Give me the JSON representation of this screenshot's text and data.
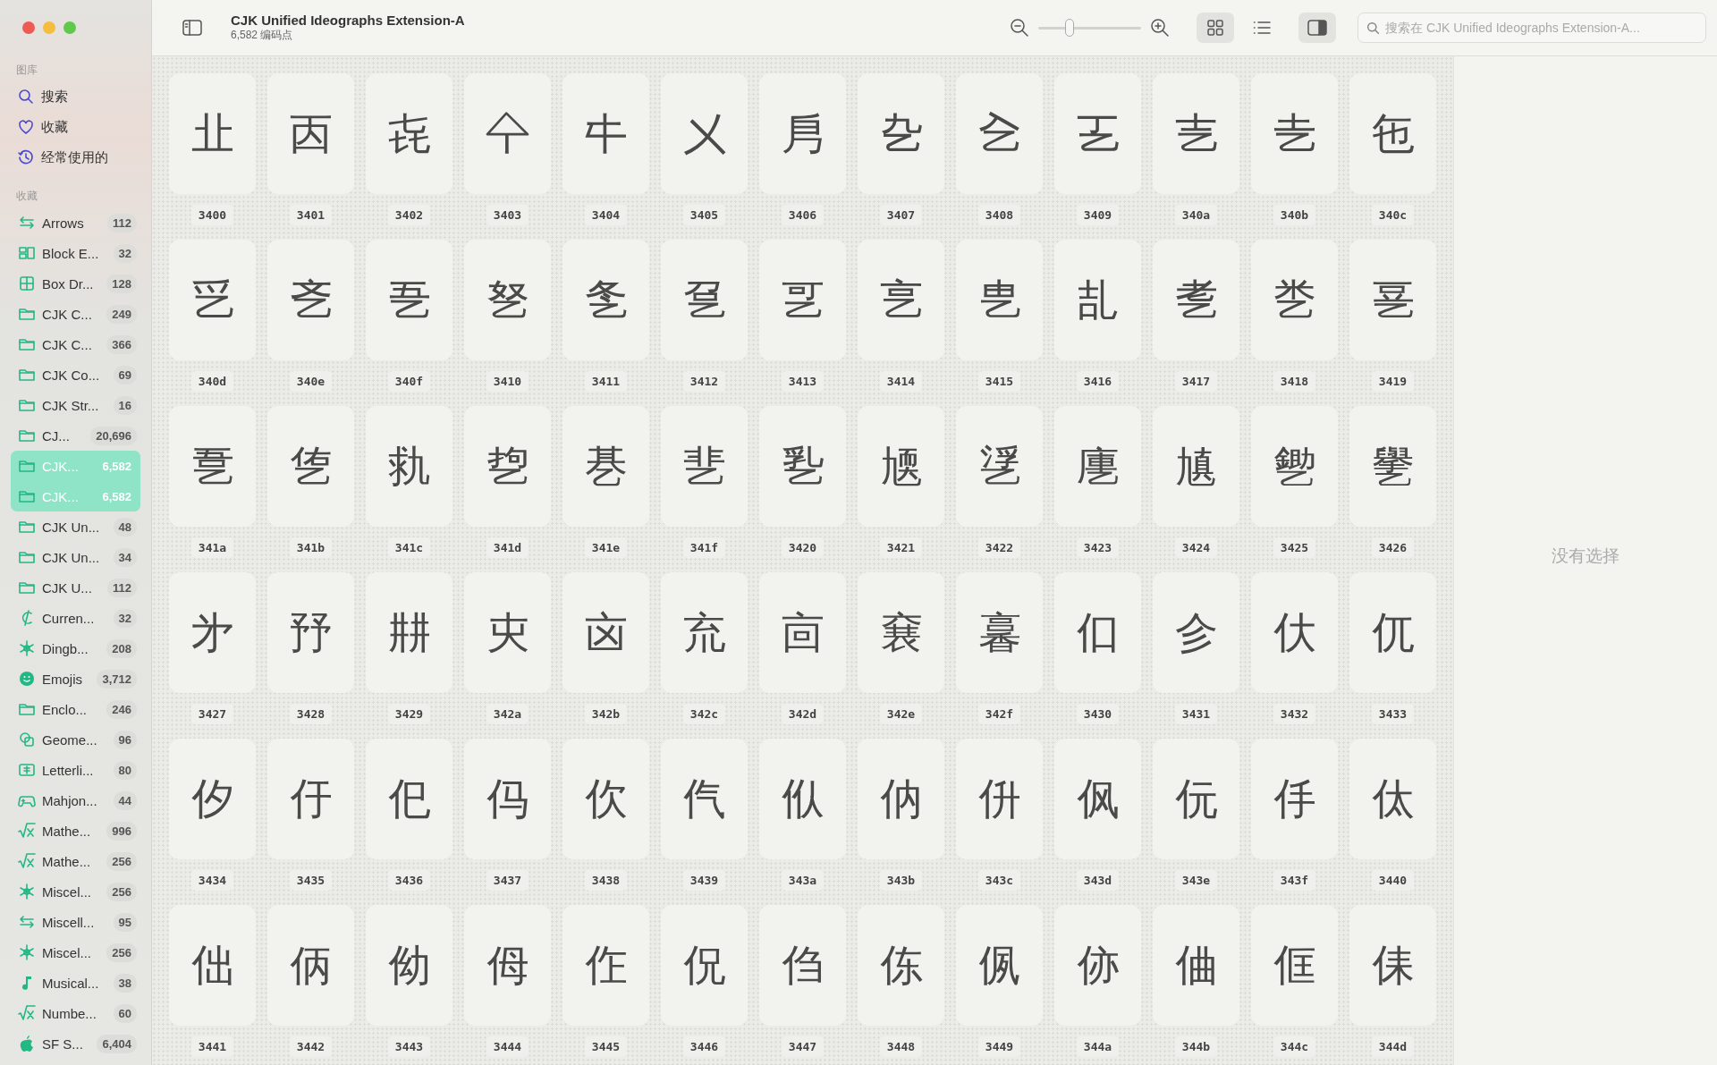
{
  "window": {
    "title": "CJK Unified Ideographs Extension-A",
    "subtitle": "6,582 编码点"
  },
  "sidebar": {
    "library_heading": "图库",
    "library": [
      {
        "label": "搜索",
        "kind": "search"
      },
      {
        "label": "收藏",
        "kind": "heart"
      },
      {
        "label": "经常使用的",
        "kind": "history"
      }
    ],
    "collections_heading": "收藏",
    "collections": [
      {
        "label": "Arrows",
        "count": "112",
        "kind": "arrows",
        "selected": false
      },
      {
        "label": "Block E...",
        "count": "32",
        "kind": "block",
        "selected": false
      },
      {
        "label": "Box Dr...",
        "count": "128",
        "kind": "box",
        "selected": false
      },
      {
        "label": "CJK C...",
        "count": "249",
        "kind": "folder",
        "selected": false
      },
      {
        "label": "CJK C...",
        "count": "366",
        "kind": "folder",
        "selected": false
      },
      {
        "label": "CJK Co...",
        "count": "69",
        "kind": "folder",
        "selected": false
      },
      {
        "label": "CJK Str...",
        "count": "16",
        "kind": "folder",
        "selected": false
      },
      {
        "label": "CJ...",
        "count": "20,696",
        "kind": "folder",
        "selected": false
      },
      {
        "label": "CJK...",
        "count": "6,582",
        "kind": "folder",
        "selected": true
      },
      {
        "label": "CJK...",
        "count": "6,582",
        "kind": "folder",
        "selected": true
      },
      {
        "label": "CJK Un...",
        "count": "48",
        "kind": "folder",
        "selected": false
      },
      {
        "label": "CJK Un...",
        "count": "34",
        "kind": "folder",
        "selected": false
      },
      {
        "label": "CJK U...",
        "count": "112",
        "kind": "folder",
        "selected": false
      },
      {
        "label": "Curren...",
        "count": "32",
        "kind": "currency",
        "selected": false
      },
      {
        "label": "Dingb...",
        "count": "208",
        "kind": "asterisk",
        "selected": false
      },
      {
        "label": "Emojis",
        "count": "3,712",
        "kind": "emoji",
        "selected": false
      },
      {
        "label": "Enclo...",
        "count": "246",
        "kind": "folder",
        "selected": false
      },
      {
        "label": "Geome...",
        "count": "96",
        "kind": "shapes",
        "selected": false
      },
      {
        "label": "Letterli...",
        "count": "80",
        "kind": "letterlike",
        "selected": false
      },
      {
        "label": "Mahjon...",
        "count": "44",
        "kind": "gamepad",
        "selected": false
      },
      {
        "label": "Mathe...",
        "count": "996",
        "kind": "math",
        "selected": false
      },
      {
        "label": "Mathe...",
        "count": "256",
        "kind": "math",
        "selected": false
      },
      {
        "label": "Miscel...",
        "count": "256",
        "kind": "asterisk",
        "selected": false
      },
      {
        "label": "Miscell...",
        "count": "95",
        "kind": "arrows",
        "selected": false
      },
      {
        "label": "Miscel...",
        "count": "256",
        "kind": "asterisk",
        "selected": false
      },
      {
        "label": "Musical...",
        "count": "38",
        "kind": "music",
        "selected": false
      },
      {
        "label": "Numbe...",
        "count": "60",
        "kind": "math",
        "selected": false
      },
      {
        "label": "SF S...",
        "count": "6,404",
        "kind": "apple",
        "selected": false
      }
    ]
  },
  "toolbar": {
    "zoom": {
      "level": 0.3
    },
    "views": [
      {
        "kind": "grid",
        "selected": true
      },
      {
        "kind": "list",
        "selected": false
      }
    ],
    "inspector_on": true,
    "search_placeholder": "搜索在 CJK Unified Ideographs Extension-A..."
  },
  "glyphs": [
    {
      "char": "㐀",
      "code": "3400"
    },
    {
      "char": "㐁",
      "code": "3401"
    },
    {
      "char": "㐂",
      "code": "3402"
    },
    {
      "char": "㐃",
      "code": "3403"
    },
    {
      "char": "㐄",
      "code": "3404"
    },
    {
      "char": "㐅",
      "code": "3405"
    },
    {
      "char": "㐆",
      "code": "3406"
    },
    {
      "char": "㐇",
      "code": "3407"
    },
    {
      "char": "㐈",
      "code": "3408"
    },
    {
      "char": "㐉",
      "code": "3409"
    },
    {
      "char": "㐊",
      "code": "340a"
    },
    {
      "char": "㐋",
      "code": "340b"
    },
    {
      "char": "㐌",
      "code": "340c"
    },
    {
      "char": "㐍",
      "code": "340d"
    },
    {
      "char": "㐎",
      "code": "340e"
    },
    {
      "char": "㐏",
      "code": "340f"
    },
    {
      "char": "㐐",
      "code": "3410"
    },
    {
      "char": "㐑",
      "code": "3411"
    },
    {
      "char": "㐒",
      "code": "3412"
    },
    {
      "char": "㐓",
      "code": "3413"
    },
    {
      "char": "㐔",
      "code": "3414"
    },
    {
      "char": "㐕",
      "code": "3415"
    },
    {
      "char": "㐖",
      "code": "3416"
    },
    {
      "char": "㐗",
      "code": "3417"
    },
    {
      "char": "㐘",
      "code": "3418"
    },
    {
      "char": "㐙",
      "code": "3419"
    },
    {
      "char": "㐚",
      "code": "341a"
    },
    {
      "char": "㐛",
      "code": "341b"
    },
    {
      "char": "㐜",
      "code": "341c"
    },
    {
      "char": "㐝",
      "code": "341d"
    },
    {
      "char": "㐞",
      "code": "341e"
    },
    {
      "char": "㐟",
      "code": "341f"
    },
    {
      "char": "㐠",
      "code": "3420"
    },
    {
      "char": "㐡",
      "code": "3421"
    },
    {
      "char": "㐢",
      "code": "3422"
    },
    {
      "char": "㐣",
      "code": "3423"
    },
    {
      "char": "㐤",
      "code": "3424"
    },
    {
      "char": "㐥",
      "code": "3425"
    },
    {
      "char": "㐦",
      "code": "3426"
    },
    {
      "char": "㐧",
      "code": "3427"
    },
    {
      "char": "㐨",
      "code": "3428"
    },
    {
      "char": "㐩",
      "code": "3429"
    },
    {
      "char": "㐪",
      "code": "342a"
    },
    {
      "char": "㐫",
      "code": "342b"
    },
    {
      "char": "㐬",
      "code": "342c"
    },
    {
      "char": "㐭",
      "code": "342d"
    },
    {
      "char": "㐮",
      "code": "342e"
    },
    {
      "char": "㐯",
      "code": "342f"
    },
    {
      "char": "㐰",
      "code": "3430"
    },
    {
      "char": "㐱",
      "code": "3431"
    },
    {
      "char": "㐲",
      "code": "3432"
    },
    {
      "char": "㐳",
      "code": "3433"
    },
    {
      "char": "㐴",
      "code": "3434"
    },
    {
      "char": "㐵",
      "code": "3435"
    },
    {
      "char": "㐶",
      "code": "3436"
    },
    {
      "char": "㐷",
      "code": "3437"
    },
    {
      "char": "㐸",
      "code": "3438"
    },
    {
      "char": "㐹",
      "code": "3439"
    },
    {
      "char": "㐺",
      "code": "343a"
    },
    {
      "char": "㐻",
      "code": "343b"
    },
    {
      "char": "㐼",
      "code": "343c"
    },
    {
      "char": "㐽",
      "code": "343d"
    },
    {
      "char": "㐾",
      "code": "343e"
    },
    {
      "char": "㐿",
      "code": "343f"
    },
    {
      "char": "㑀",
      "code": "3440"
    },
    {
      "char": "㑁",
      "code": "3441"
    },
    {
      "char": "㑂",
      "code": "3442"
    },
    {
      "char": "㑃",
      "code": "3443"
    },
    {
      "char": "㑄",
      "code": "3444"
    },
    {
      "char": "㑅",
      "code": "3445"
    },
    {
      "char": "㑆",
      "code": "3446"
    },
    {
      "char": "㑇",
      "code": "3447"
    },
    {
      "char": "㑈",
      "code": "3448"
    },
    {
      "char": "㑉",
      "code": "3449"
    },
    {
      "char": "㑊",
      "code": "344a"
    },
    {
      "char": "㑋",
      "code": "344b"
    },
    {
      "char": "㑌",
      "code": "344c"
    },
    {
      "char": "㑍",
      "code": "344d"
    }
  ],
  "inspector": {
    "empty_text": "没有选择"
  }
}
